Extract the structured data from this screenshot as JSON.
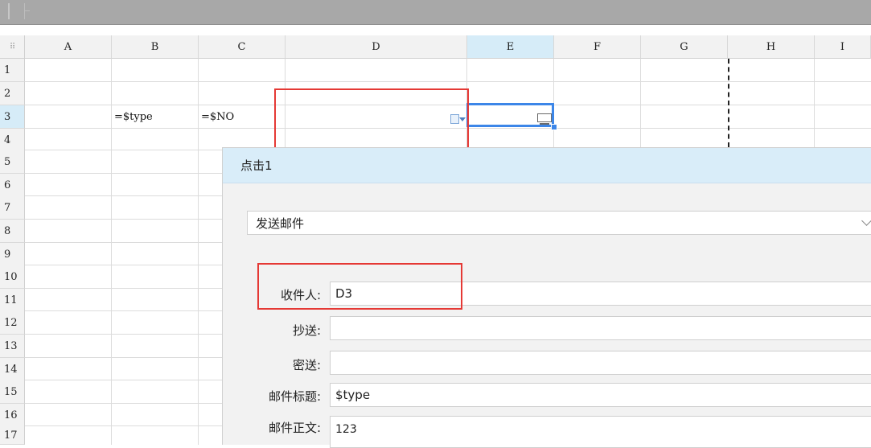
{
  "sheet": {
    "columns": [
      "A",
      "B",
      "C",
      "D",
      "E",
      "F",
      "G",
      "H",
      "I"
    ],
    "rows": [
      "1",
      "2",
      "3",
      "4",
      "5",
      "6",
      "7",
      "8",
      "9",
      "10",
      "11",
      "12",
      "13",
      "14",
      "15",
      "16",
      "17"
    ],
    "selected_column": "E",
    "selected_row": "3",
    "cells": {
      "B3": "=$type",
      "C3": "=$NO"
    },
    "corner_glyph": "⠿"
  },
  "panel": {
    "title": "点击1",
    "action_select": "发送邮件",
    "fields": [
      {
        "label": "收件人:",
        "value": "D3"
      },
      {
        "label": "抄送:",
        "value": ""
      },
      {
        "label": "密送:",
        "value": ""
      },
      {
        "label": "邮件标题:",
        "value": "$type"
      },
      {
        "label": "邮件正文:",
        "value": "123"
      }
    ]
  },
  "colors": {
    "selection_border": "#3c86e8",
    "highlight_box": "#e53935",
    "panel_header": "#d9edf9",
    "selected_header": "#d6ecf8"
  },
  "icons": [
    "dropdown-widget-icon",
    "comment-icon",
    "chevron-down-icon",
    "grip-icon"
  ]
}
